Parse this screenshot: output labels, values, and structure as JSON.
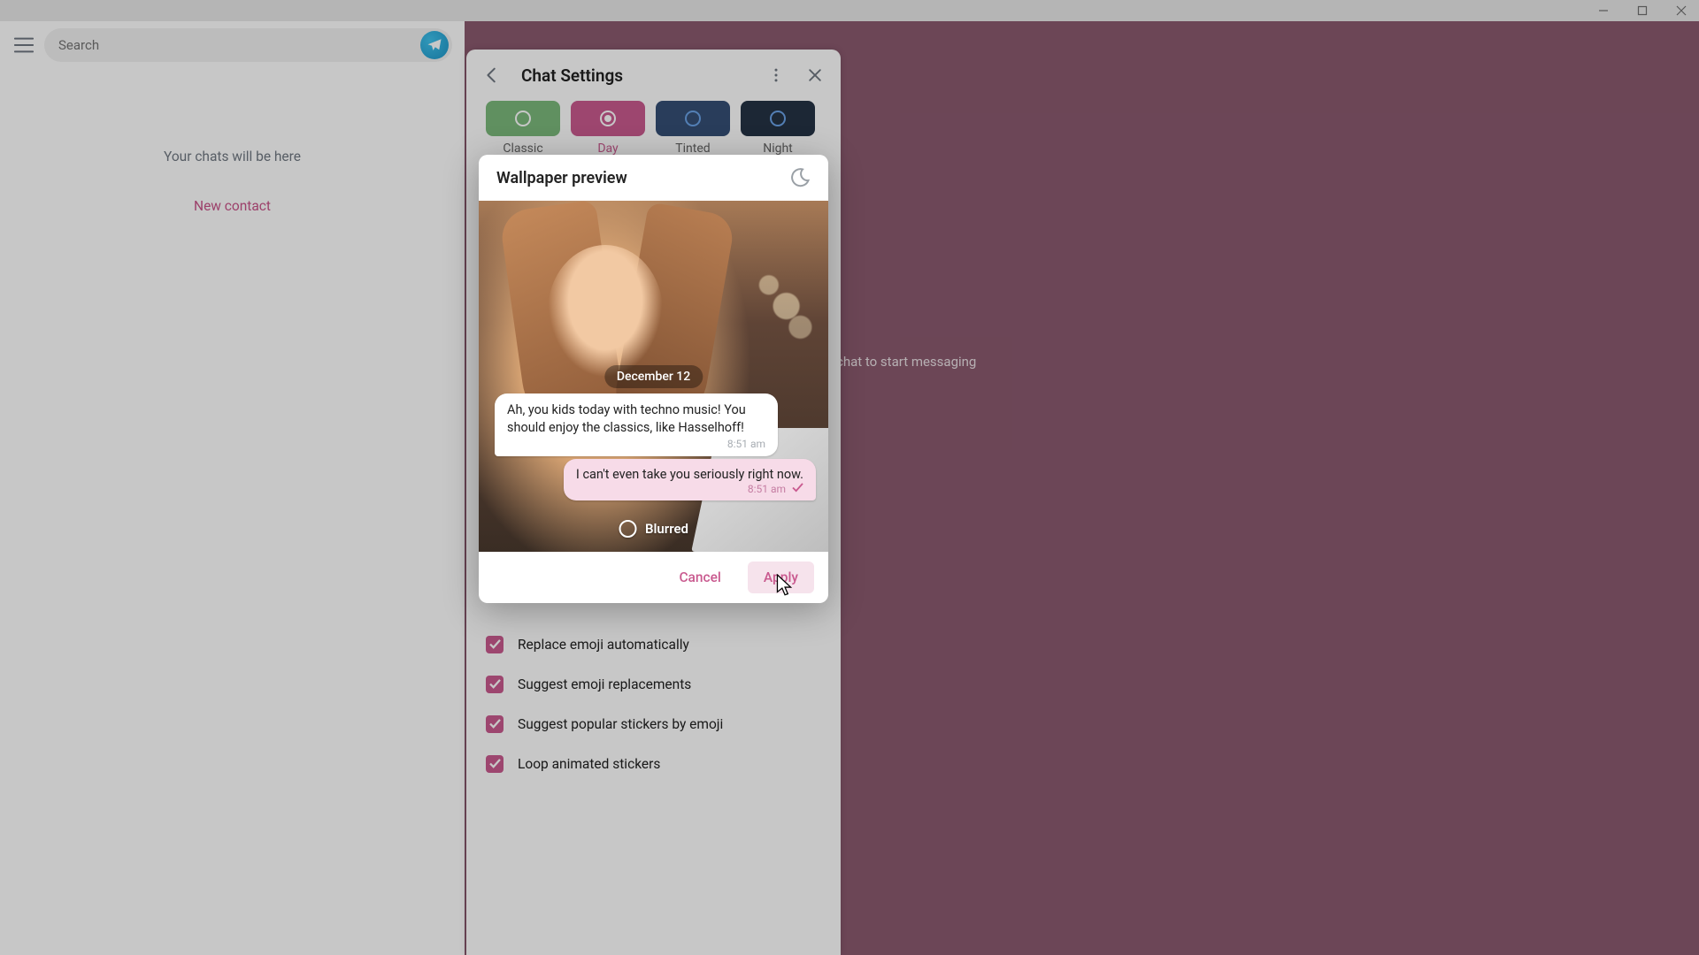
{
  "window": {
    "title": ""
  },
  "left": {
    "search_placeholder": "Search",
    "empty_hint": "Your chats will be here",
    "new_contact": "New contact"
  },
  "right": {
    "hint": "chat to start messaging"
  },
  "settings": {
    "title": "Chat Settings",
    "themes": [
      {
        "key": "classic",
        "label": "Classic",
        "selected": false
      },
      {
        "key": "day",
        "label": "Day",
        "selected": true
      },
      {
        "key": "tinted",
        "label": "Tinted",
        "selected": false
      },
      {
        "key": "night",
        "label": "Night",
        "selected": false
      }
    ],
    "checks": [
      {
        "label": "Replace emoji automatically",
        "checked": true
      },
      {
        "label": "Suggest emoji replacements",
        "checked": true
      },
      {
        "label": "Suggest popular stickers by emoji",
        "checked": true
      },
      {
        "label": "Loop animated stickers",
        "checked": true
      }
    ]
  },
  "modal": {
    "title": "Wallpaper preview",
    "date": "December 12",
    "msg_in": {
      "text": "Ah, you kids today with techno music! You should enjoy the classics, like Hasselhoff!",
      "time": "8:51 am"
    },
    "msg_out": {
      "text": "I can't even take you seriously right now.",
      "time": "8:51 am"
    },
    "blurred_label": "Blurred",
    "blurred_on": false,
    "cancel": "Cancel",
    "apply": "Apply"
  },
  "colors": {
    "accent": "#c95a8f"
  }
}
